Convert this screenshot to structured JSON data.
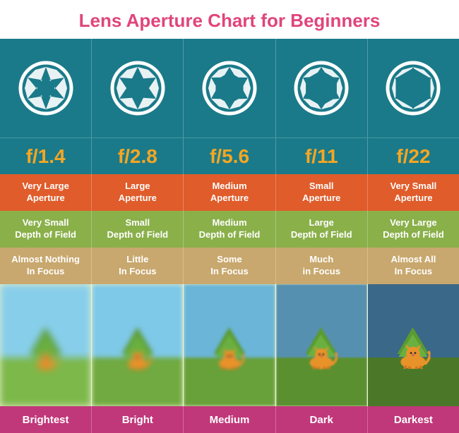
{
  "title": "Lens Aperture Chart for Beginners",
  "columns": [
    {
      "fstop": "f/1.4",
      "aperture_label": "Very Large\nAperture",
      "dof_label": "Very Small\nDepth of Field",
      "focus_label": "Almost Nothing\nIn Focus",
      "brightness_label": "Brightest",
      "blur_level": 4
    },
    {
      "fstop": "f/2.8",
      "aperture_label": "Large\nAperture",
      "dof_label": "Small\nDepth of Field",
      "focus_label": "Little\nIn Focus",
      "brightness_label": "Bright",
      "blur_level": 3
    },
    {
      "fstop": "f/5.6",
      "aperture_label": "Medium\nAperture",
      "dof_label": "Medium\nDepth of Field",
      "focus_label": "Some\nIn Focus",
      "brightness_label": "Medium",
      "blur_level": 2
    },
    {
      "fstop": "f/11",
      "aperture_label": "Small\nAperture",
      "dof_label": "Large\nDepth of Field",
      "focus_label": "Much\nin Focus",
      "brightness_label": "Dark",
      "blur_level": 1
    },
    {
      "fstop": "f/22",
      "aperture_label": "Very Small\nAperture",
      "dof_label": "Very Large\nDepth of Field",
      "focus_label": "Almost All\nIn Focus",
      "brightness_label": "Darkest",
      "blur_level": 0
    }
  ],
  "aperture_open_amounts": [
    0.85,
    0.65,
    0.45,
    0.3,
    0.15
  ]
}
